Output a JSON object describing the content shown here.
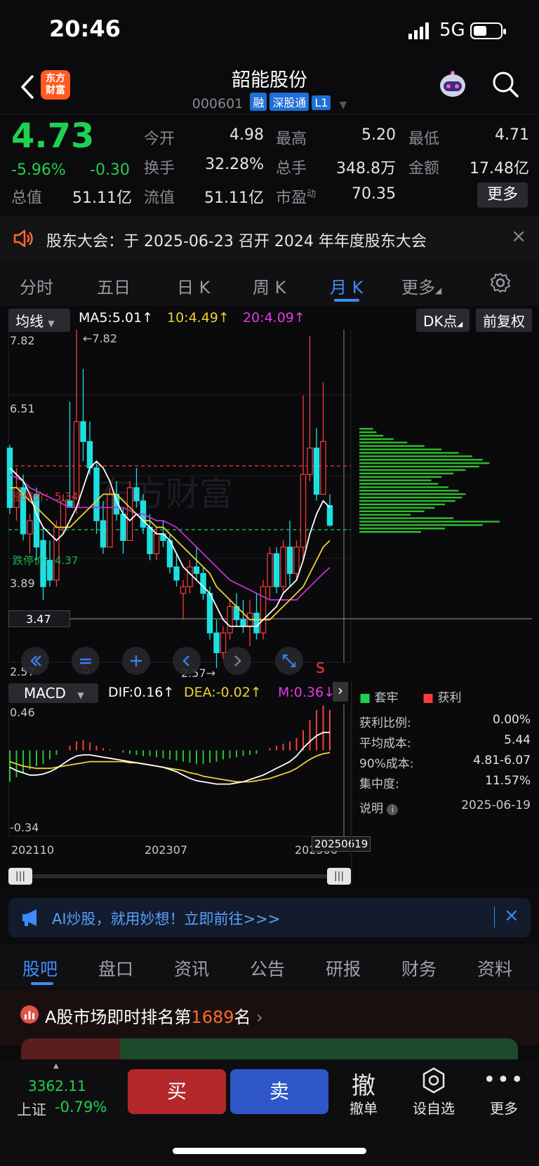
{
  "status": {
    "time": "20:46",
    "network": "5G"
  },
  "header": {
    "title": "韶能股份",
    "code": "000601",
    "tags": [
      "融",
      "深股通",
      "L1"
    ],
    "logo": "东方\n财富"
  },
  "quote": {
    "price": "4.73",
    "change_pct": "-5.96%",
    "change": "-0.30",
    "rows": [
      [
        {
          "k": "今开",
          "v": "4.98",
          "c": "g"
        },
        {
          "k": "最高",
          "v": "5.20",
          "c": "r"
        },
        {
          "k": "最低",
          "v": "4.71",
          "c": "g"
        }
      ],
      [
        {
          "k": "换手",
          "v": "32.28%",
          "c": "w"
        },
        {
          "k": "总手",
          "v": "348.8万",
          "c": "w"
        },
        {
          "k": "金额",
          "v": "17.48亿",
          "c": "w"
        }
      ],
      [
        {
          "k": "总值",
          "v": "51.11亿",
          "c": "w"
        },
        {
          "k": "流值",
          "v": "51.11亿",
          "c": "w"
        },
        {
          "k": "市盈",
          "sup": "动",
          "v": "70.35",
          "c": "w"
        }
      ]
    ],
    "more": "更多"
  },
  "notice": {
    "text": "股东大会：于 2025-06-23 召开 2024 年年度股东大会",
    "close": "×"
  },
  "tabs": [
    "分时",
    "五日",
    "日 K",
    "周 K",
    "月 K",
    "更多"
  ],
  "active_tab": 4,
  "kline": {
    "ma_select": "均线",
    "ma5": "MA5:5.01",
    "ma10": "10:4.49",
    "ma20": "20:4.09",
    "dk": "DK点",
    "fq": "前复权",
    "y_ticks": [
      "7.82",
      "6.51",
      "3.89",
      "2.57"
    ],
    "high_mark": "←7.82",
    "low_mark": "2.57→",
    "cursor_price": "3.47",
    "resist_label": "涨停价：5.34",
    "support_label": "跌停价：4.37",
    "s_marks": [
      "S",
      "S"
    ],
    "watermark": "东方财富"
  },
  "macd": {
    "select": "MACD",
    "dif": "DIF:0.16",
    "dea": "DEA:-0.02",
    "m": "M:0.36",
    "top": "0.46",
    "bottom": "-0.34"
  },
  "dates": {
    "d1": "202110",
    "d2": "202307",
    "d3": "202506",
    "cursor": "20250619"
  },
  "chip": {
    "legend_trap": "套牢",
    "legend_profit": "获利",
    "rows": [
      {
        "k": "获利比例:",
        "v": "0.00%"
      },
      {
        "k": "平均成本:",
        "v": "5.44"
      },
      {
        "k": "90%成本:",
        "v": "4.81-6.07"
      },
      {
        "k": "集中度:",
        "v": "11.57%"
      }
    ],
    "note": "说明",
    "date": "2025-06-19"
  },
  "ai_banner": {
    "text": "AI炒股，就用妙想！立即前往>>>",
    "close": "×"
  },
  "bottom_tabs": [
    "股吧",
    "盘口",
    "资讯",
    "公告",
    "研报",
    "财务",
    "资料"
  ],
  "rank": {
    "prefix": "A股市场即时排名第",
    "num": "1689",
    "suffix": "名"
  },
  "footer": {
    "index_val": "3362.11",
    "index_name": "上证",
    "index_chg": "-0.79%",
    "buy": "买",
    "sell": "卖",
    "cancel_glyph": "撤",
    "cancel": "撤单",
    "fav": "设自选",
    "more": "更多"
  },
  "chart_data": {
    "type": "candlestick",
    "candles": [
      {
        "o": 5.9,
        "h": 5.95,
        "l": 4.9,
        "c": 5.0
      },
      {
        "o": 5.0,
        "h": 5.6,
        "l": 4.8,
        "c": 5.3
      },
      {
        "o": 5.3,
        "h": 5.5,
        "l": 4.5,
        "c": 4.6
      },
      {
        "o": 4.6,
        "h": 4.9,
        "l": 4.3,
        "c": 4.8
      },
      {
        "o": 5.2,
        "h": 5.3,
        "l": 4.2,
        "c": 4.4
      },
      {
        "o": 4.5,
        "h": 4.7,
        "l": 3.6,
        "c": 3.8
      },
      {
        "o": 4.2,
        "h": 4.5,
        "l": 3.8,
        "c": 3.9
      },
      {
        "o": 3.9,
        "h": 4.8,
        "l": 3.8,
        "c": 4.7
      },
      {
        "o": 4.7,
        "h": 5.2,
        "l": 4.6,
        "c": 5.1
      },
      {
        "o": 5.1,
        "h": 6.6,
        "l": 5.0,
        "c": 5.0
      },
      {
        "o": 5.0,
        "h": 7.82,
        "l": 4.9,
        "c": 6.3
      },
      {
        "o": 6.3,
        "h": 7.1,
        "l": 5.7,
        "c": 6.0
      },
      {
        "o": 6.0,
        "h": 6.3,
        "l": 5.5,
        "c": 5.6
      },
      {
        "o": 5.6,
        "h": 5.7,
        "l": 4.6,
        "c": 4.8
      },
      {
        "o": 4.8,
        "h": 5.1,
        "l": 4.3,
        "c": 4.4
      },
      {
        "o": 4.4,
        "h": 5.3,
        "l": 4.4,
        "c": 5.2
      },
      {
        "o": 5.2,
        "h": 5.4,
        "l": 4.8,
        "c": 4.9
      },
      {
        "o": 4.9,
        "h": 5.0,
        "l": 4.3,
        "c": 4.5
      },
      {
        "o": 4.5,
        "h": 5.4,
        "l": 4.5,
        "c": 5.3
      },
      {
        "o": 5.3,
        "h": 5.6,
        "l": 5.0,
        "c": 5.1
      },
      {
        "o": 5.1,
        "h": 5.2,
        "l": 4.6,
        "c": 4.7
      },
      {
        "o": 4.7,
        "h": 4.9,
        "l": 4.2,
        "c": 4.3
      },
      {
        "o": 4.3,
        "h": 4.7,
        "l": 4.2,
        "c": 4.6
      },
      {
        "o": 4.6,
        "h": 4.8,
        "l": 4.4,
        "c": 4.5
      },
      {
        "o": 4.5,
        "h": 4.6,
        "l": 4.0,
        "c": 4.1
      },
      {
        "o": 4.1,
        "h": 4.3,
        "l": 3.8,
        "c": 3.9
      },
      {
        "o": 3.7,
        "h": 3.9,
        "l": 3.3,
        "c": 3.8
      },
      {
        "o": 3.8,
        "h": 4.2,
        "l": 3.7,
        "c": 4.1
      },
      {
        "o": 4.1,
        "h": 4.4,
        "l": 3.9,
        "c": 4.0
      },
      {
        "o": 4.0,
        "h": 4.1,
        "l": 3.6,
        "c": 3.7
      },
      {
        "o": 3.7,
        "h": 3.8,
        "l": 3.0,
        "c": 3.1
      },
      {
        "o": 3.1,
        "h": 3.3,
        "l": 2.57,
        "c": 2.8
      },
      {
        "o": 2.8,
        "h": 3.2,
        "l": 2.7,
        "c": 3.1
      },
      {
        "o": 3.1,
        "h": 3.6,
        "l": 3.0,
        "c": 3.5
      },
      {
        "o": 3.5,
        "h": 3.7,
        "l": 3.2,
        "c": 3.3
      },
      {
        "o": 3.3,
        "h": 3.6,
        "l": 3.1,
        "c": 3.2
      },
      {
        "o": 3.2,
        "h": 3.6,
        "l": 2.9,
        "c": 3.4
      },
      {
        "o": 3.4,
        "h": 3.7,
        "l": 3.0,
        "c": 3.1
      },
      {
        "o": 3.1,
        "h": 3.9,
        "l": 3.0,
        "c": 3.8
      },
      {
        "o": 3.8,
        "h": 4.4,
        "l": 3.6,
        "c": 4.3
      },
      {
        "o": 4.3,
        "h": 4.4,
        "l": 3.7,
        "c": 3.8
      },
      {
        "o": 3.8,
        "h": 4.5,
        "l": 3.7,
        "c": 4.4
      },
      {
        "o": 4.4,
        "h": 4.8,
        "l": 3.8,
        "c": 4.0
      },
      {
        "o": 4.0,
        "h": 4.5,
        "l": 3.9,
        "c": 4.4
      },
      {
        "o": 4.4,
        "h": 6.7,
        "l": 4.2,
        "c": 5.5
      },
      {
        "o": 5.5,
        "h": 7.6,
        "l": 5.4,
        "c": 5.9
      },
      {
        "o": 5.9,
        "h": 6.2,
        "l": 5.1,
        "c": 5.2
      },
      {
        "o": 5.2,
        "h": 6.9,
        "l": 5.2,
        "c": 6.0
      },
      {
        "o": 5.03,
        "h": 5.2,
        "l": 4.71,
        "c": 4.73
      }
    ],
    "ma5": [
      5.6,
      5.5,
      5.4,
      5.2,
      4.9,
      4.7,
      4.6,
      4.5,
      4.6,
      4.8,
      5.0,
      5.3,
      5.6,
      5.7,
      5.6,
      5.4,
      5.1,
      4.9,
      4.8,
      4.9,
      4.8,
      4.7,
      4.6,
      4.6,
      4.5,
      4.3,
      4.1,
      4.0,
      3.9,
      3.8,
      3.7,
      3.5,
      3.3,
      3.2,
      3.2,
      3.2,
      3.2,
      3.2,
      3.3,
      3.4,
      3.5,
      3.7,
      3.8,
      3.9,
      4.2,
      4.6,
      4.9,
      5.1,
      5.0
    ],
    "ma10": [
      5.3,
      5.3,
      5.2,
      5.1,
      5.0,
      4.9,
      4.8,
      4.7,
      4.7,
      4.7,
      4.8,
      4.9,
      5.0,
      5.1,
      5.2,
      5.2,
      5.2,
      5.1,
      5.0,
      4.9,
      4.8,
      4.8,
      4.7,
      4.7,
      4.6,
      4.5,
      4.4,
      4.3,
      4.2,
      4.1,
      4.0,
      3.8,
      3.7,
      3.6,
      3.5,
      3.4,
      3.3,
      3.3,
      3.3,
      3.3,
      3.4,
      3.5,
      3.6,
      3.7,
      3.8,
      4.0,
      4.2,
      4.4,
      4.5
    ],
    "ma20": [
      5.5,
      5.45,
      5.4,
      5.3,
      5.25,
      5.2,
      5.15,
      5.1,
      5.05,
      5.0,
      5.0,
      5.0,
      5.0,
      5.0,
      5.0,
      5.0,
      5.0,
      5.0,
      4.95,
      4.9,
      4.9,
      4.85,
      4.8,
      4.8,
      4.75,
      4.7,
      4.6,
      4.5,
      4.4,
      4.3,
      4.2,
      4.1,
      4.0,
      3.9,
      3.85,
      3.8,
      3.75,
      3.7,
      3.65,
      3.6,
      3.6,
      3.6,
      3.6,
      3.6,
      3.7,
      3.8,
      3.9,
      4.0,
      4.09
    ],
    "macd_hist": [
      -0.28,
      -0.24,
      -0.2,
      -0.17,
      -0.14,
      -0.12,
      -0.08,
      -0.04,
      0.0,
      0.04,
      0.08,
      0.09,
      0.07,
      0.04,
      0.02,
      0.01,
      0.0,
      -0.02,
      -0.03,
      -0.04,
      -0.05,
      -0.05,
      -0.06,
      -0.07,
      -0.08,
      -0.09,
      -0.1,
      -0.11,
      -0.12,
      -0.12,
      -0.11,
      -0.1,
      -0.08,
      -0.07,
      -0.06,
      -0.05,
      -0.04,
      -0.03,
      0.0,
      0.02,
      0.04,
      0.06,
      0.08,
      0.11,
      0.18,
      0.27,
      0.36,
      0.4,
      0.36
    ],
    "dif": [
      -0.15,
      -0.18,
      -0.2,
      -0.22,
      -0.22,
      -0.21,
      -0.19,
      -0.16,
      -0.12,
      -0.08,
      -0.05,
      -0.04,
      -0.04,
      -0.05,
      -0.06,
      -0.07,
      -0.08,
      -0.09,
      -0.1,
      -0.11,
      -0.12,
      -0.13,
      -0.14,
      -0.15,
      -0.17,
      -0.19,
      -0.22,
      -0.25,
      -0.27,
      -0.28,
      -0.29,
      -0.3,
      -0.3,
      -0.3,
      -0.29,
      -0.28,
      -0.26,
      -0.24,
      -0.22,
      -0.19,
      -0.16,
      -0.13,
      -0.1,
      -0.05,
      0.02,
      0.08,
      0.13,
      0.16,
      0.16
    ],
    "dea": [
      -0.1,
      -0.12,
      -0.14,
      -0.15,
      -0.16,
      -0.16,
      -0.16,
      -0.15,
      -0.14,
      -0.13,
      -0.12,
      -0.11,
      -0.1,
      -0.1,
      -0.1,
      -0.1,
      -0.1,
      -0.1,
      -0.11,
      -0.11,
      -0.12,
      -0.13,
      -0.14,
      -0.15,
      -0.16,
      -0.17,
      -0.18,
      -0.2,
      -0.21,
      -0.23,
      -0.24,
      -0.25,
      -0.26,
      -0.27,
      -0.28,
      -0.28,
      -0.28,
      -0.27,
      -0.26,
      -0.25,
      -0.23,
      -0.21,
      -0.19,
      -0.16,
      -0.12,
      -0.08,
      -0.05,
      -0.03,
      -0.02
    ],
    "chip_bars": [
      0.08,
      0.1,
      0.14,
      0.2,
      0.28,
      0.38,
      0.48,
      0.58,
      0.66,
      0.72,
      0.76,
      0.7,
      0.62,
      0.55,
      0.48,
      0.42,
      0.46,
      0.52,
      0.58,
      0.62,
      0.6,
      0.56,
      0.5,
      0.44,
      0.38,
      0.3,
      0.55,
      0.82,
      0.72,
      0.5,
      0.36
    ],
    "ylim": [
      2.57,
      7.82
    ],
    "macd_ylim": [
      -0.34,
      0.46
    ]
  }
}
